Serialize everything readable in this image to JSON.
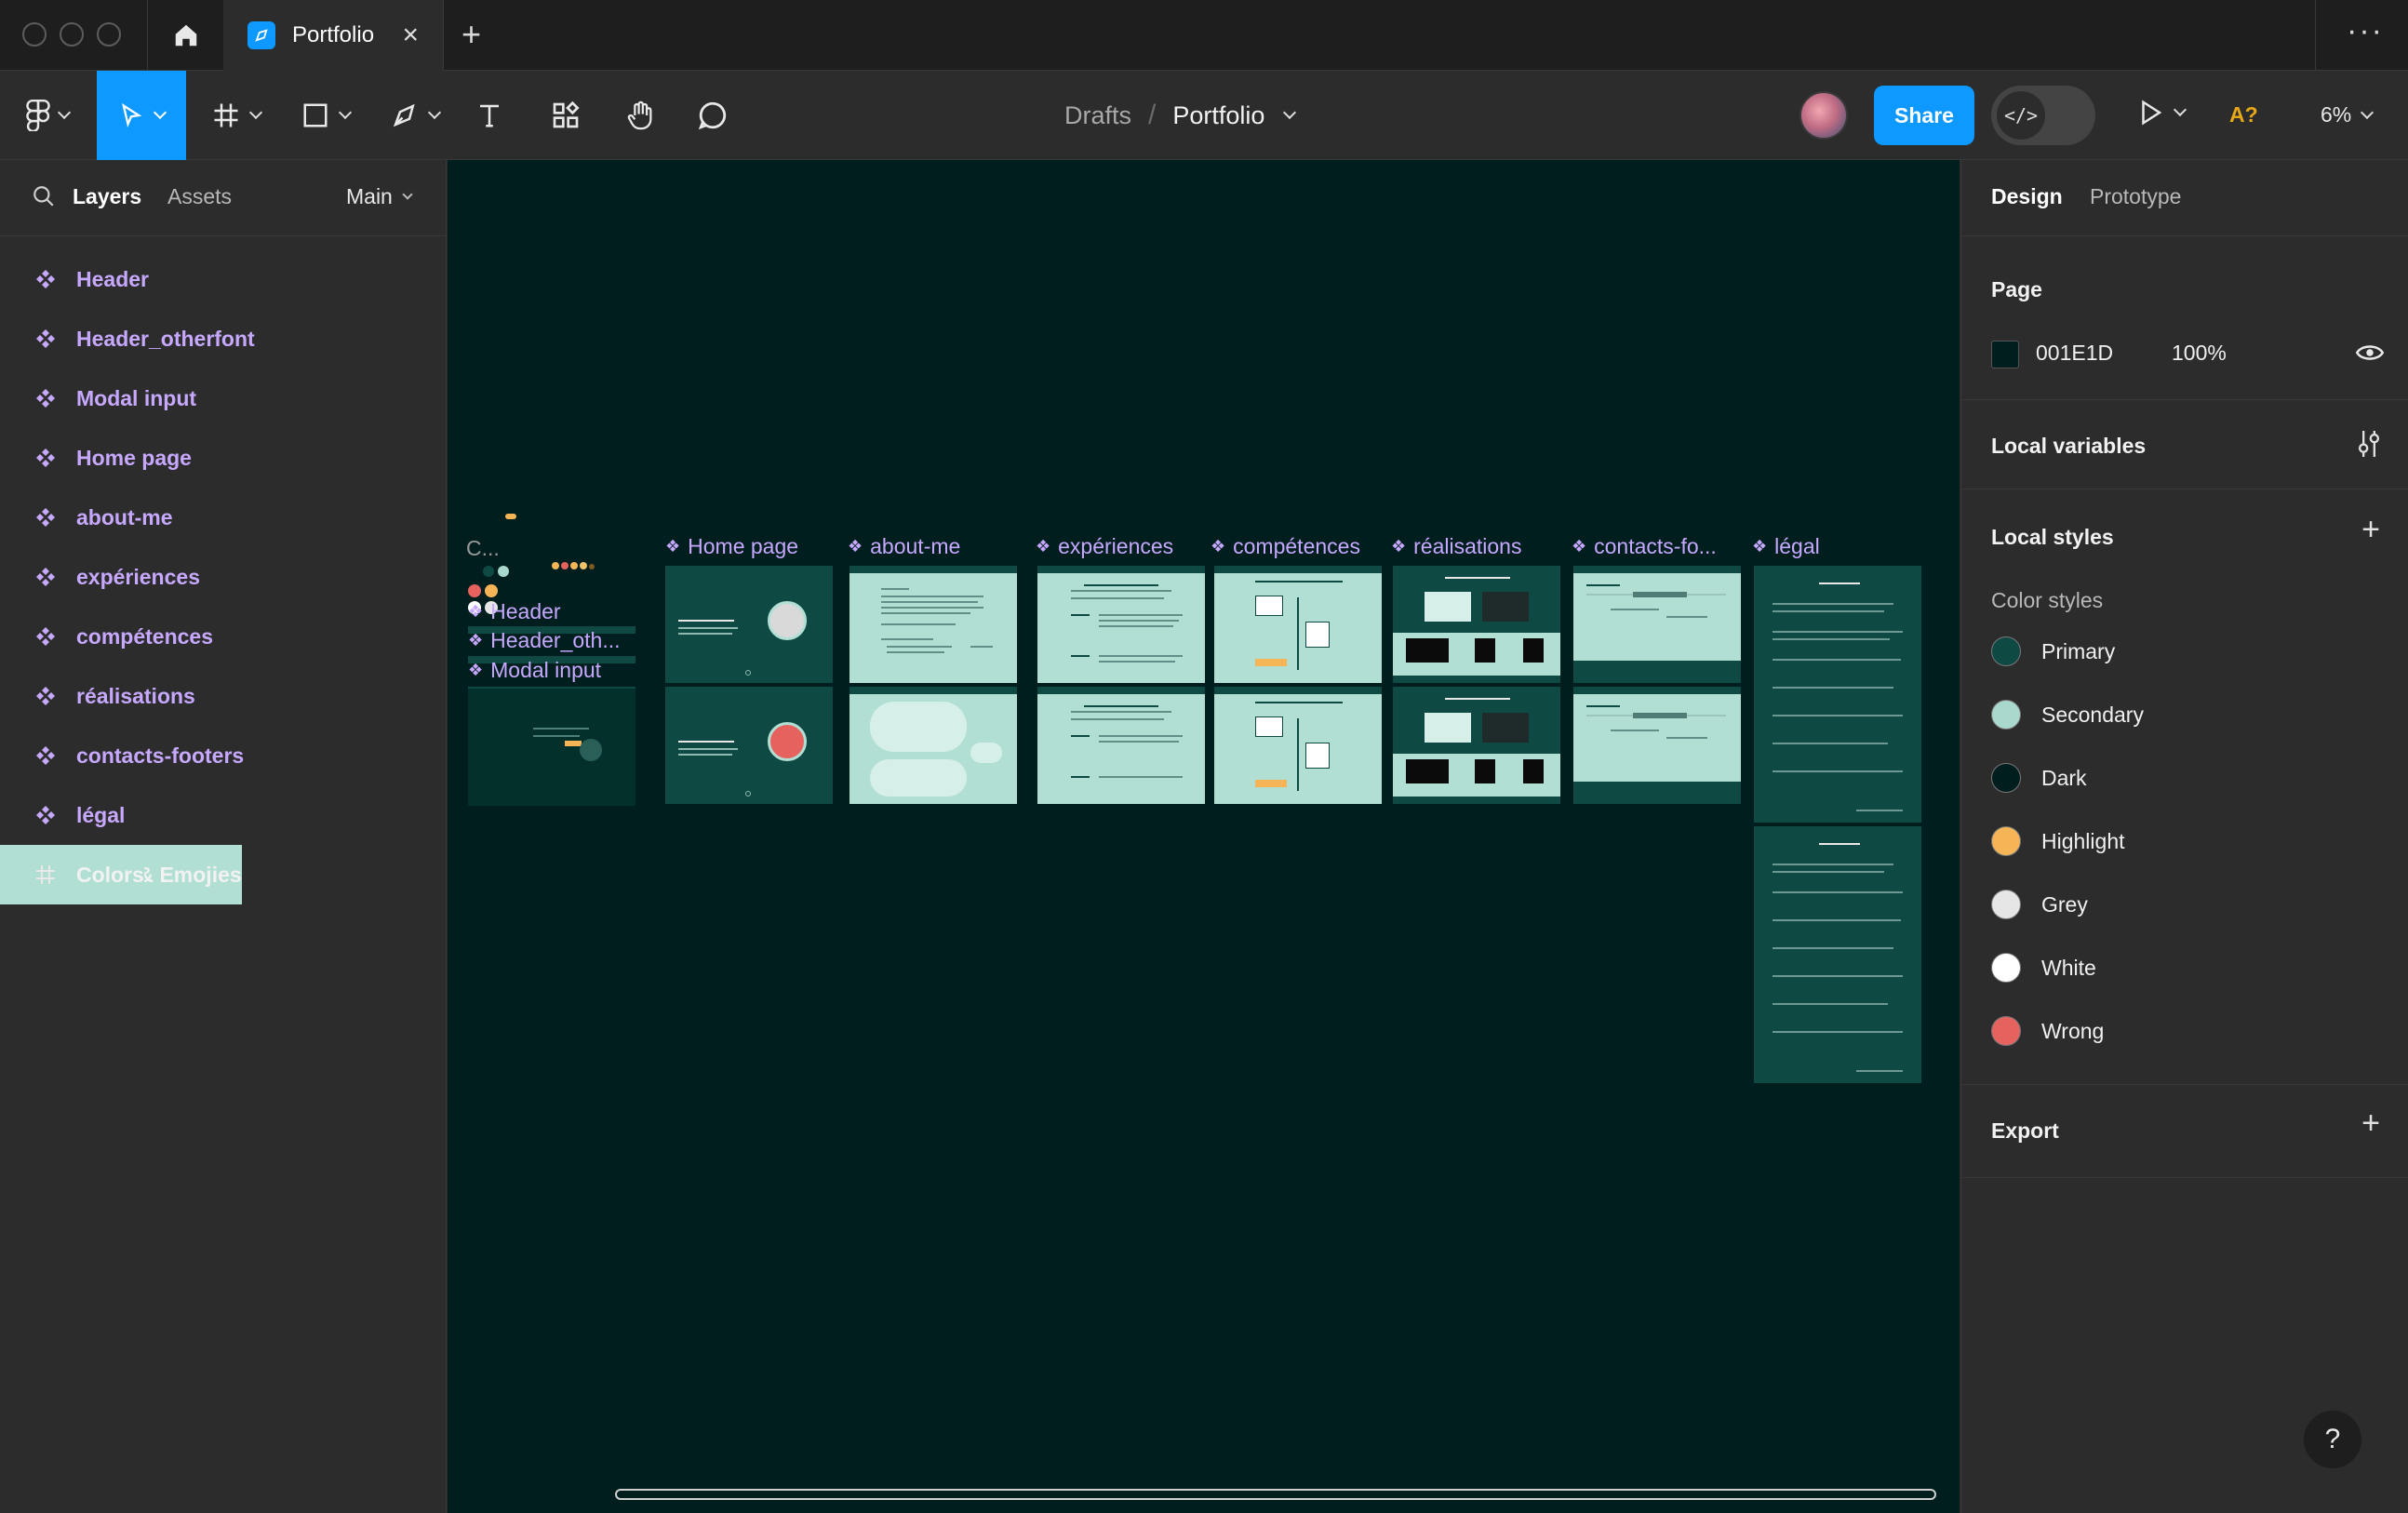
{
  "tab": {
    "title": "Portfolio"
  },
  "toolbar": {
    "breadcrumb": {
      "parent": "Drafts",
      "file": "Portfolio"
    },
    "share_label": "Share",
    "ai_badge": "A?",
    "zoom": "6%"
  },
  "left_panel": {
    "tabs": {
      "layers": "Layers",
      "assets": "Assets"
    },
    "page": "Main",
    "layers": [
      {
        "label": "Header",
        "type": "component"
      },
      {
        "label": "Header_otherfont",
        "type": "component"
      },
      {
        "label": "Modal input",
        "type": "component"
      },
      {
        "label": "Home page",
        "type": "component"
      },
      {
        "label": "about-me",
        "type": "component"
      },
      {
        "label": "expériences",
        "type": "component"
      },
      {
        "label": "compétences",
        "type": "component"
      },
      {
        "label": "réalisations",
        "type": "component"
      },
      {
        "label": "contacts-footers",
        "type": "component"
      },
      {
        "label": "légal",
        "type": "component"
      },
      {
        "label": "Icons & Emojies",
        "type": "frame"
      },
      {
        "label": "Colors",
        "type": "frame"
      }
    ]
  },
  "canvas": {
    "background": "#001E1D",
    "frame_labels": {
      "colors": "C...",
      "home": "Home page",
      "about": "about-me",
      "exp": "expériences",
      "comp": "compétences",
      "real": "réalisations",
      "contacts": "contacts-fo...",
      "legal": "légal",
      "header": "Header",
      "header_other": "Header_oth...",
      "modal": "Modal input"
    }
  },
  "right_panel": {
    "tabs": {
      "design": "Design",
      "prototype": "Prototype"
    },
    "page": {
      "title": "Page",
      "color_hex": "001E1D",
      "opacity": "100%"
    },
    "local_variables": "Local variables",
    "local_styles": "Local styles",
    "color_styles_title": "Color styles",
    "color_styles": [
      {
        "name": "Primary",
        "color": "#0E4A43"
      },
      {
        "name": "Secondary",
        "color": "#A9D8CC"
      },
      {
        "name": "Dark",
        "color": "#001E1D"
      },
      {
        "name": "Highlight",
        "color": "#F5B556"
      },
      {
        "name": "Grey",
        "color": "#E6E6E6"
      },
      {
        "name": "White",
        "color": "#FFFFFF"
      },
      {
        "name": "Wrong",
        "color": "#E5625E"
      }
    ],
    "export": "Export"
  },
  "help_label": "?"
}
